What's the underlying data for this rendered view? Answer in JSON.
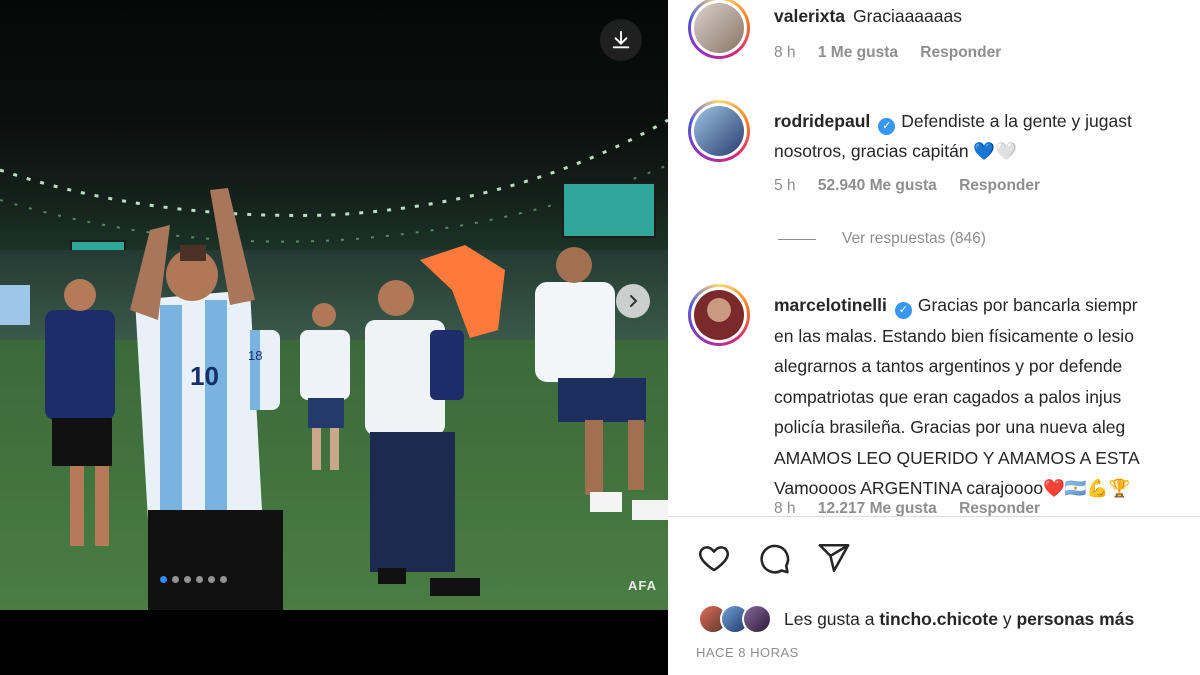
{
  "post": {
    "photo_watermark": "AFA",
    "carousel": {
      "total": 6,
      "active_index": 0
    }
  },
  "comments": [
    {
      "username": "valerixta",
      "verified": false,
      "text": "Graciaaaaaas",
      "time": "8 h",
      "likes": "1 Me gusta",
      "reply": "Responder"
    },
    {
      "username": "rodridepaul",
      "verified": true,
      "text_line1": "Defendiste a la gente y jugast",
      "text_line2": "nosotros, gracias capitán 💙🤍",
      "time": "5 h",
      "likes": "52.940 Me gusta",
      "reply": "Responder",
      "view_replies": "Ver respuestas (846)"
    },
    {
      "username": "marcelotinelli",
      "verified": true,
      "lines": [
        "Gracias por bancarla siempr",
        "en las malas. Estando bien físicamente o lesio",
        "alegrarnos a tantos argentinos y por defende",
        "compatriotas que eran cagados a palos injus",
        "policía brasileña. Gracias por una nueva aleg",
        "AMAMOS LEO QUERIDO Y AMAMOS A ESTA",
        "Vamoooos ARGENTINA carajoooo❤️🇦🇷💪🏆"
      ],
      "time": "8 h",
      "likes": "12.217 Me gusta",
      "reply": "Responder"
    }
  ],
  "footer": {
    "likes_prefix": "Les gusta a",
    "likes_user": "tincho.chicote",
    "likes_connector": "y",
    "likes_suffix": "personas más",
    "timestamp": "HACE 8 HORAS"
  },
  "icons": {
    "download": "download-icon",
    "next": "chevron-right-icon",
    "like": "heart-icon",
    "comment": "comment-icon",
    "share": "send-icon",
    "verified": "verified-badge-icon"
  },
  "colors": {
    "verified": "#3897f0",
    "carousel_active": "#2f8bff",
    "muted_text": "#8e8e8e"
  }
}
